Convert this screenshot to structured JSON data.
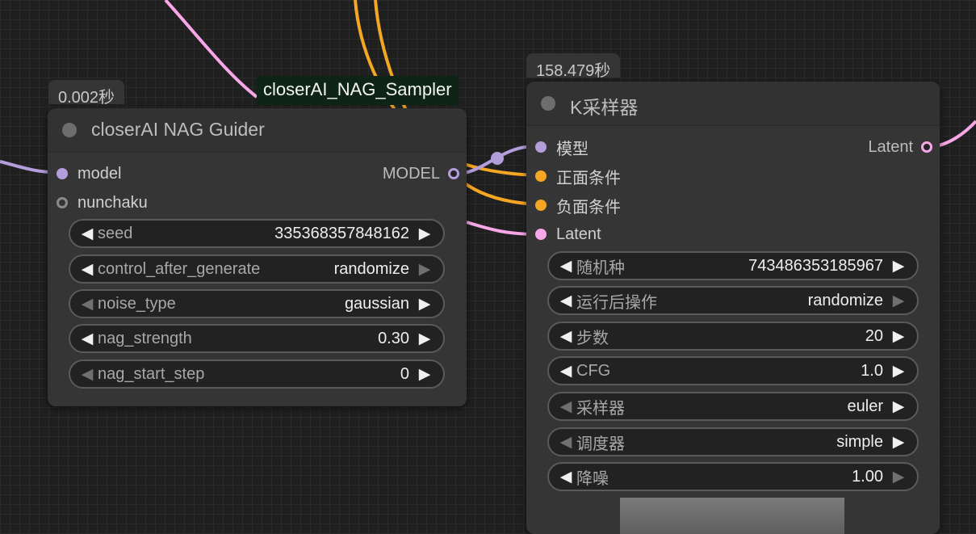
{
  "guider_node": {
    "timing": "0.002秒",
    "title": "closerAI NAG Guider",
    "inputs": [
      {
        "label": "model"
      },
      {
        "label": "nunchaku"
      }
    ],
    "output": {
      "label": "MODEL"
    },
    "widgets": [
      {
        "label": "seed",
        "value": "335368357848162"
      },
      {
        "label": "control_after_generate",
        "value": "randomize"
      },
      {
        "label": "noise_type",
        "value": "gaussian"
      },
      {
        "label": "nag_strength",
        "value": "0.30"
      },
      {
        "label": "nag_start_step",
        "value": "0"
      }
    ]
  },
  "sampler_badge": {
    "title": "closerAI_NAG_Sampler"
  },
  "ksampler_node": {
    "timing": "158.479秒",
    "title": "K采样器",
    "inputs": [
      {
        "label": "模型"
      },
      {
        "label": "正面条件"
      },
      {
        "label": "负面条件"
      },
      {
        "label": "Latent"
      }
    ],
    "output": {
      "label": "Latent"
    },
    "widgets": [
      {
        "label": "随机种",
        "value": "743486353185967"
      },
      {
        "label": "运行后操作",
        "value": "randomize"
      },
      {
        "label": "步数",
        "value": "20"
      },
      {
        "label": "CFG",
        "value": "1.0"
      },
      {
        "label": "采样器",
        "value": "euler"
      },
      {
        "label": "调度器",
        "value": "simple"
      },
      {
        "label": "降噪",
        "value": "1.00"
      }
    ]
  },
  "colors": {
    "model_wire": "#b39ddb",
    "conditioning_wire": "#f5a623",
    "latent_wire": "#f7a7e7"
  }
}
